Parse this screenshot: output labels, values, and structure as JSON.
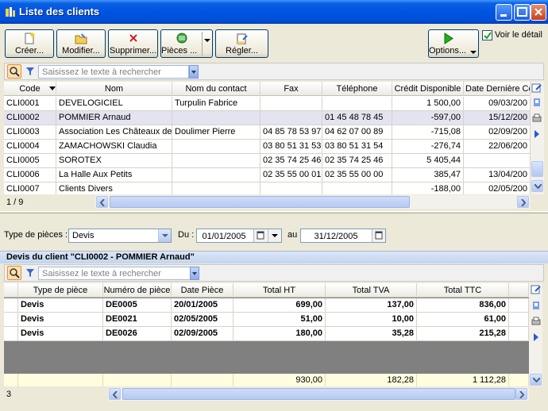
{
  "window": {
    "title": "Liste des clients"
  },
  "toolbar": {
    "create": "Créer...",
    "modify": "Modifier...",
    "delete": "Supprimer...",
    "pieces": "Pièces ...",
    "settle": "Régler...",
    "options": "Options...",
    "show_detail": "Voir le détail"
  },
  "search": {
    "placeholder": "Saisissez le texte à rechercher"
  },
  "clients": {
    "headers": [
      "Code",
      "Nom",
      "Nom du contact",
      "Fax",
      "Téléphone",
      "Crédit Disponible",
      "Date Dernière Co"
    ],
    "rows": [
      [
        "CLI0001",
        "DEVELOGICIEL",
        "Turpulin Fabrice",
        "",
        "",
        "1 500,00",
        "09/03/200"
      ],
      [
        "CLI0002",
        "POMMIER Arnaud",
        "",
        "",
        "01 45 48 78 45",
        "-597,00",
        "15/12/200"
      ],
      [
        "CLI0003",
        "Association Les Châteaux de F",
        "Doulimer Pierre",
        "04 85 78 53 97",
        "04 62 07 00 89",
        "-715,08",
        "02/09/200"
      ],
      [
        "CLI0004",
        "ZAMACHOWSKI Claudia",
        "",
        "03 80 51 31 53",
        "03 80 51 31 54",
        "-276,74",
        "22/06/200"
      ],
      [
        "CLI0005",
        "SOROTEX",
        "",
        "02 35 74 25 46",
        "02 35 74 25 46",
        "5 405,44",
        ""
      ],
      [
        "CLI0006",
        "La Halle Aux Petits",
        "",
        "02 35 55 00 01",
        "02 35 55 00 00",
        "385,47",
        "13/04/200"
      ],
      [
        "CLI0007",
        "Clients Divers",
        "",
        "",
        "",
        "-188,00",
        "02/05/200"
      ]
    ],
    "count": "1 / 9"
  },
  "filter": {
    "type_label": "Type de pièces :",
    "type_value": "Devis",
    "from_label": "Du :",
    "from_value": "01/01/2005",
    "to_label": "au",
    "to_value": "31/12/2005"
  },
  "detail": {
    "title": "Devis du client \"CLI0002 - POMMIER Arnaud\"",
    "headers": [
      "Type de pièce",
      "Numéro de pièce",
      "Date Pièce",
      "Total HT",
      "Total TVA",
      "Total TTC"
    ],
    "rows": [
      [
        "Devis",
        "DE0005",
        "20/01/2005",
        "699,00",
        "137,00",
        "836,00"
      ],
      [
        "Devis",
        "DE0021",
        "02/05/2005",
        "51,00",
        "10,00",
        "61,00"
      ],
      [
        "Devis",
        "DE0026",
        "02/09/2005",
        "180,00",
        "35,28",
        "215,28"
      ]
    ],
    "totals": [
      "930,00",
      "182,28",
      "1 112,28"
    ],
    "count": "3"
  },
  "colors": {
    "titlebar": "#0054e3",
    "selected_row": "#e4e3f0",
    "totals_bg": "#fffde0"
  }
}
